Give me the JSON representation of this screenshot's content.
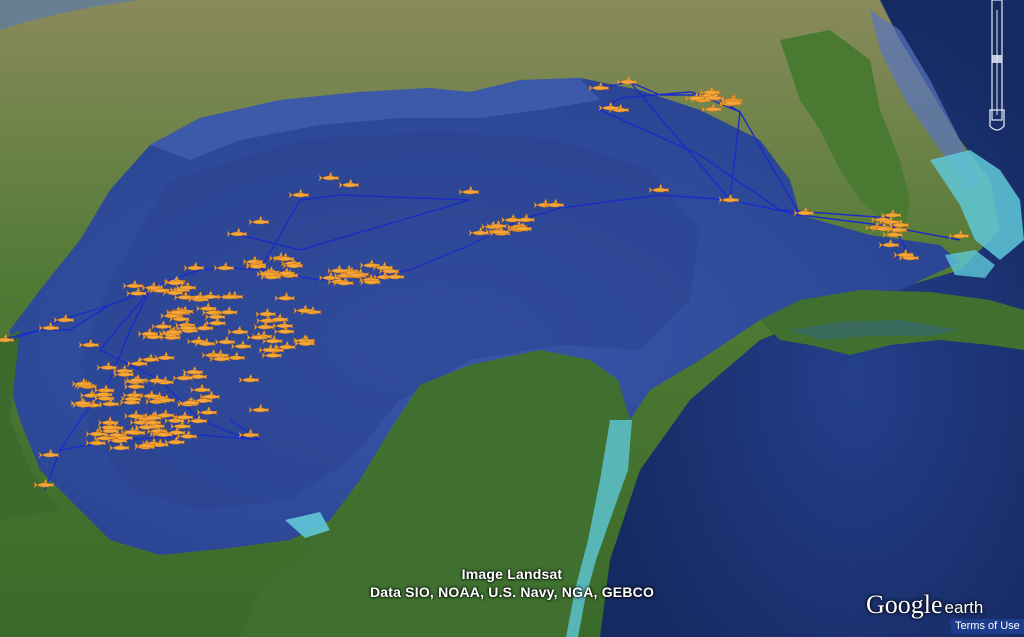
{
  "attribution": {
    "line1": "Image Landsat",
    "line2": "Data SIO, NOAA, U.S. Navy, NGA, GEBCO"
  },
  "logo": {
    "brand": "Google",
    "product": "earth"
  },
  "terms_link": "Terms of Use",
  "colors": {
    "ocean_deep": "#1b2f6e",
    "ocean_gulf": "#2f4fa0",
    "shelf": "#5a78c8",
    "land_green": "#3c6a2a",
    "land_dry": "#8c8a5a",
    "track_line": "#1a2cc8",
    "shark_marker": "#f5a83a",
    "shallow_reef": "#5fc8d8"
  },
  "icons": {
    "marker": "shark-icon",
    "navigation": "zoom-slider-icon"
  }
}
